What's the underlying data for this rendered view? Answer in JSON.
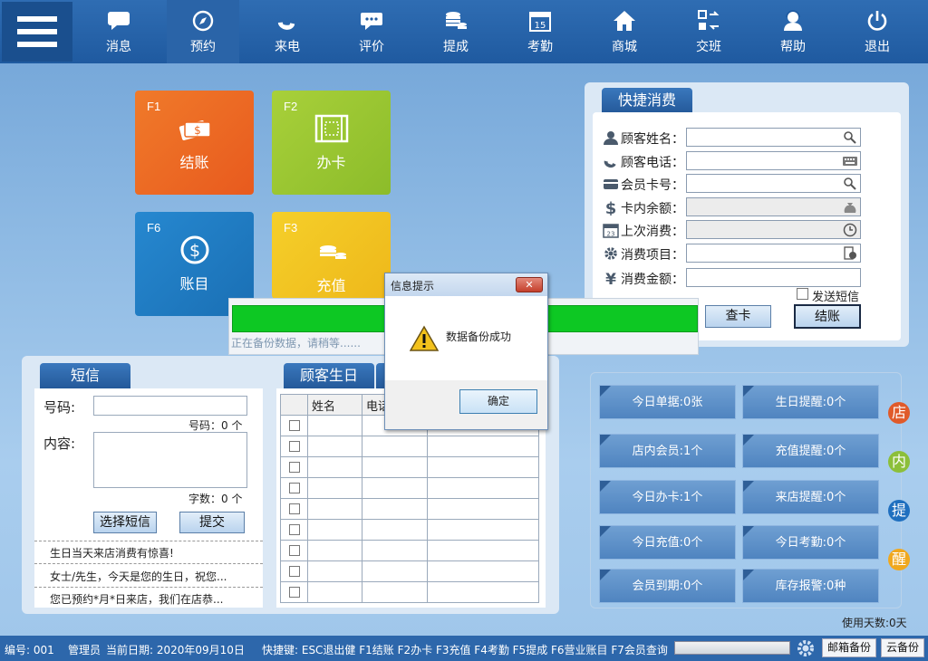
{
  "nav": [
    {
      "label": "消息",
      "icon": "chat-bubble-icon"
    },
    {
      "label": "预约",
      "icon": "compass-icon"
    },
    {
      "label": "来电",
      "icon": "phone-icon"
    },
    {
      "label": "评价",
      "icon": "comment-icon"
    },
    {
      "label": "提成",
      "icon": "coins-icon"
    },
    {
      "label": "考勤",
      "icon": "calendar-icon",
      "day": "15"
    },
    {
      "label": "商城",
      "icon": "home-icon"
    },
    {
      "label": "交班",
      "icon": "swap-icon"
    },
    {
      "label": "帮助",
      "icon": "support-agent-icon"
    },
    {
      "label": "退出",
      "icon": "power-icon"
    }
  ],
  "tiles": [
    {
      "key": "F1",
      "label": "结账",
      "color": "#ec6a24"
    },
    {
      "key": "F2",
      "label": "办卡",
      "color": "#9cc531"
    },
    {
      "key": "F6",
      "label": "账目",
      "color": "#1f7cc4"
    },
    {
      "key": "F3",
      "label": "充值",
      "color": "#f1c21e"
    }
  ],
  "quick": {
    "title": "快捷消费",
    "fields": [
      {
        "label": "顾客姓名：",
        "icon": "user-icon",
        "action": "search-icon"
      },
      {
        "label": "顾客电话：",
        "icon": "phone-icon",
        "action": "keyboard-icon"
      },
      {
        "label": "会员卡号：",
        "icon": "card-icon",
        "action": "search-icon"
      },
      {
        "label": "卡内余额：",
        "icon": "dollar-icon",
        "action": "money-bag-icon"
      },
      {
        "label": "上次消费：",
        "icon": "calendar-icon",
        "action": "clock-icon"
      },
      {
        "label": "消费项目：",
        "icon": "gear-icon",
        "action": "list-icon"
      },
      {
        "label": "消费金额：",
        "icon": "yen-icon",
        "action": ""
      }
    ],
    "send_sms": "发送短信",
    "check_card": "查卡",
    "checkout": "结账"
  },
  "sms": {
    "title": "短信",
    "number_label": "号码:",
    "number_count": "号码：0 个",
    "content_label": "内容:",
    "char_count": "字数：0 个",
    "choose_btn": "选择短信",
    "submit_btn": "提交",
    "templates": [
      "生日当天来店消费有惊喜!",
      "女士/先生，今天是您的生日，祝您...",
      "您已预约*月*日来店，我们在店恭..."
    ]
  },
  "birthday": {
    "title": "顾客生日",
    "columns": [
      "",
      "姓名",
      "电话",
      ""
    ]
  },
  "reminders": {
    "items": [
      "今日单据:0张",
      "生日提醒:0个",
      "店内会员:1个",
      "充值提醒:0个",
      "今日办卡:1个",
      "来店提醒:0个",
      "今日充值:0个",
      "今日考勤:0个",
      "会员到期:0个",
      "库存报警:0种"
    ],
    "side": [
      {
        "text": "店",
        "color": "#e05a2a"
      },
      {
        "text": "内",
        "color": "#8cbf3a"
      },
      {
        "text": "提",
        "color": "#1f6fbf"
      },
      {
        "text": "醒",
        "color": "#f0a81e"
      }
    ],
    "days_used": "使用天数:0天"
  },
  "progress": {
    "text": "正在备份数据，请稍等......",
    "value": 1.0
  },
  "dialog": {
    "title": "信息提示",
    "close": "✕",
    "message": "数据备份成功",
    "ok": "确定"
  },
  "status": {
    "id": "编号: 001",
    "role": "管理员",
    "date": "当前日期: 2020年09月10日",
    "shortcuts": "快捷键: ESC退出健 F1结账 F2办卡 F3充值 F4考勤 F5提成 F6营业账目 F7会员查询",
    "mail_backup": "邮箱备份",
    "cloud_backup": "云备份"
  }
}
